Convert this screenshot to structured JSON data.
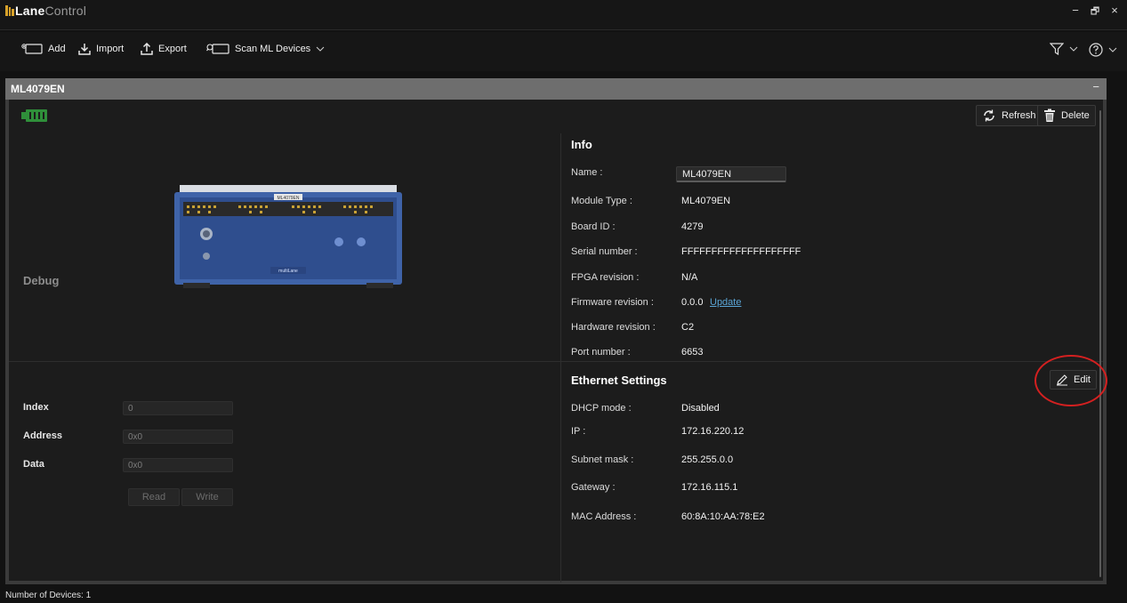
{
  "app": {
    "title_bold": "Lane",
    "title_light": "Control",
    "window_controls": [
      "−",
      "🗗",
      "×"
    ]
  },
  "toolbar": {
    "add_label": "Add",
    "import_label": "Import",
    "export_label": "Export",
    "scan_label": "Scan ML Devices"
  },
  "device": {
    "header_name": "ML4079EN",
    "collapse_symbol": "−"
  },
  "actions": {
    "refresh_label": "Refresh",
    "delete_label": "Delete",
    "edit_label": "Edit"
  },
  "info": {
    "title": "Info",
    "name_label": "Name :",
    "name_value": "ML4079EN",
    "rows": [
      {
        "label": "Module Type :",
        "value": "ML4079EN"
      },
      {
        "label": "Board ID :",
        "value": "4279"
      },
      {
        "label": "Serial number :",
        "value": "FFFFFFFFFFFFFFFFFFFF"
      },
      {
        "label": "FPGA revision :",
        "value": "N/A"
      },
      {
        "label": "Firmware revision :",
        "value": "0.0.0",
        "link": "Update"
      },
      {
        "label": "Hardware revision :",
        "value": "C2"
      },
      {
        "label": "Port number :",
        "value": "6653"
      }
    ]
  },
  "ethernet": {
    "title": "Ethernet Settings",
    "rows": [
      {
        "label": "DHCP mode :",
        "value": "Disabled"
      },
      {
        "label": "IP :",
        "value": "172.16.220.12"
      },
      {
        "label": "Subnet mask :",
        "value": "255.255.0.0"
      },
      {
        "label": "Gateway :",
        "value": "172.16.115.1"
      },
      {
        "label": "MAC Address :",
        "value": "60:8A:10:AA:78:E2"
      }
    ]
  },
  "debug": {
    "title": "Debug",
    "index_label": "Index",
    "index_value": "0",
    "address_label": "Address",
    "address_value": "0x0",
    "data_label": "Data",
    "data_value": "0x0",
    "read_label": "Read",
    "write_label": "Write"
  },
  "device_image": {
    "front_label": "ML4079EN",
    "brand": "multiLane"
  },
  "status": {
    "device_count_text": "Number of Devices: 1"
  },
  "colors": {
    "background": "#121212",
    "panel": "#1c1c1c",
    "header": "#6e6e6e",
    "link": "#5aa5d6",
    "module_icon": "#2f8f3a",
    "device_blue": "#3f63a8",
    "highlight": "#d42020"
  }
}
